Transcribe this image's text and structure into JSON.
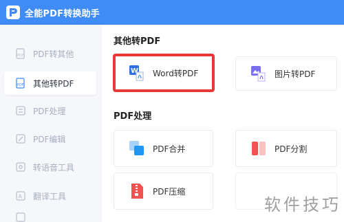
{
  "app": {
    "title": "全能PDF转换助手",
    "accent": "#3f8cf6"
  },
  "sidebar": {
    "items": [
      {
        "label": "PDF转其他",
        "icon": "pdf-doc-icon"
      },
      {
        "label": "其他转PDF",
        "icon": "pdf-doc-icon",
        "active": true
      },
      {
        "label": "PDF处理",
        "icon": "pdf-process-icon"
      },
      {
        "label": "PDF编辑",
        "icon": "pdf-edit-icon"
      },
      {
        "label": "转语音工具",
        "icon": "voice-icon"
      },
      {
        "label": "翻译工具",
        "icon": "translate-icon"
      }
    ]
  },
  "sections": {
    "other_to_pdf": {
      "title": "其他转PDF",
      "cards": [
        {
          "label": "Word转PDF",
          "icon": "word-to-pdf-icon"
        },
        {
          "label": "图片转PDF",
          "icon": "image-to-pdf-icon"
        }
      ]
    },
    "pdf_process": {
      "title": "PDF处理",
      "cards": [
        {
          "label": "PDF合并",
          "icon": "merge-icon"
        },
        {
          "label": "PDF分割",
          "icon": "split-icon"
        },
        {
          "label": "PDF压缩",
          "icon": "compress-icon"
        }
      ]
    }
  },
  "watermark": "软件技巧",
  "colors": {
    "highlight": "#e53935"
  }
}
